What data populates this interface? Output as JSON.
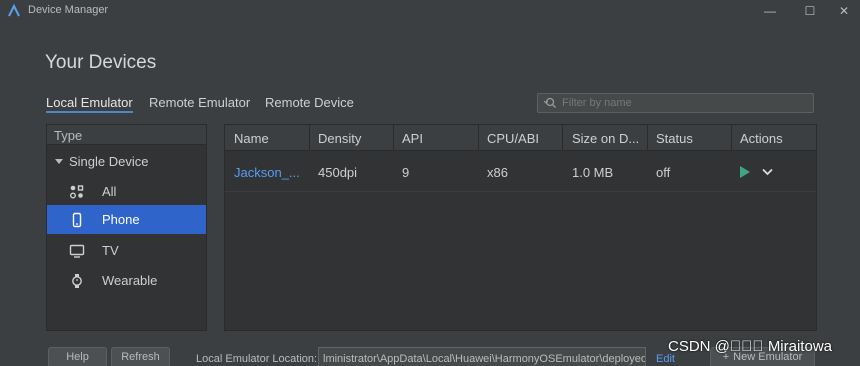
{
  "window": {
    "title": "Device Manager",
    "minimize": "—",
    "maximize": "☐",
    "close": "✕"
  },
  "page_title": "Your Devices",
  "tabs": [
    {
      "label": "Local Emulator",
      "active": true
    },
    {
      "label": "Remote Emulator",
      "active": false
    },
    {
      "label": "Remote Device",
      "active": false
    }
  ],
  "search": {
    "placeholder": "Filter by name",
    "value": ""
  },
  "sidebar": {
    "header": "Type",
    "group": "Single Device",
    "items": [
      {
        "label": "All",
        "icon": "grid-icon",
        "selected": false
      },
      {
        "label": "Phone",
        "icon": "phone-icon",
        "selected": true
      },
      {
        "label": "TV",
        "icon": "tv-icon",
        "selected": false
      },
      {
        "label": "Wearable",
        "icon": "watch-icon",
        "selected": false
      }
    ]
  },
  "table": {
    "columns": [
      "Name",
      "Density",
      "API",
      "CPU/ABI",
      "Size on D...",
      "Status",
      "Actions"
    ],
    "rows": [
      {
        "name": "Jackson_...",
        "density": "450dpi",
        "api": "9",
        "cpu": "x86",
        "size": "1.0 MB",
        "status": "off"
      }
    ]
  },
  "footer": {
    "help": "Help",
    "refresh": "Refresh",
    "location_label": "Local Emulator Location:",
    "location_value": "lministrator\\AppData\\Local\\Huawei\\HarmonyOSEmulator\\deployed",
    "edit": "Edit",
    "new_emulator": "New Emulator"
  },
  "watermark": "CSDN @\u0000\u0000\u0000 Miraitowa",
  "colors": {
    "accent": "#2f65ca",
    "link": "#589df6",
    "play": "#3fa586",
    "background": "#3c3f41"
  }
}
